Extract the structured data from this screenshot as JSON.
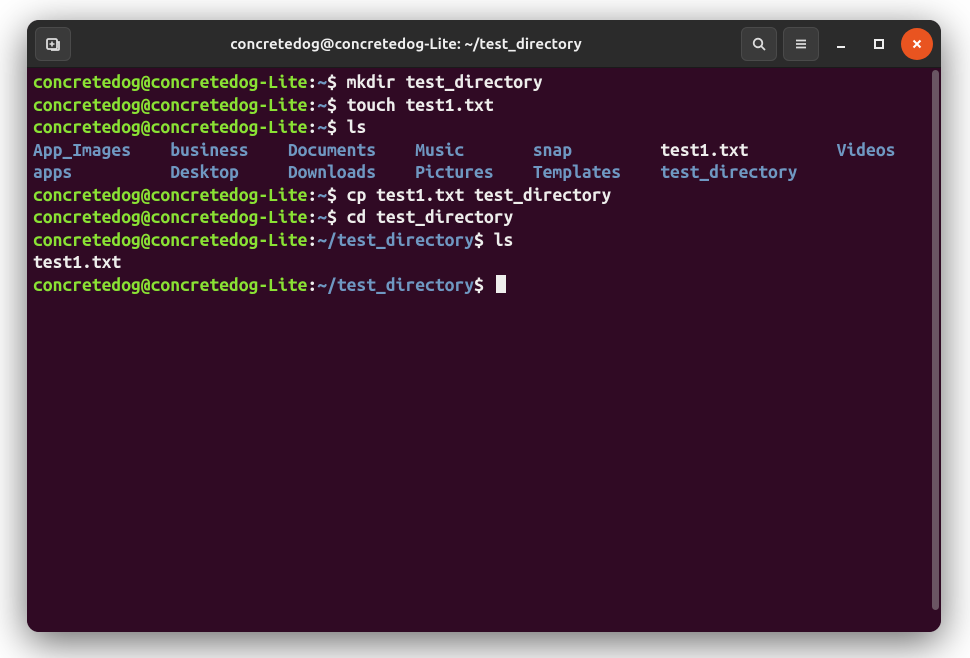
{
  "window": {
    "title": "concretedog@concretedog-Lite: ~/test_directory"
  },
  "colors": {
    "term_bg": "#300a24",
    "prompt_user": "#8ae234",
    "prompt_path": "#6f98c2",
    "text": "#eeeeec",
    "close": "#e95420",
    "titlebar": "#2b2b2b"
  },
  "prompt": {
    "user_host": "concretedog@concretedog-Lite",
    "home_path": "~",
    "sub_path": "~/test_directory",
    "sep": ":",
    "sigil": "$"
  },
  "lines": [
    {
      "type": "cmd",
      "path": "~",
      "text": "mkdir test_directory"
    },
    {
      "type": "cmd",
      "path": "~",
      "text": "touch test1.txt"
    },
    {
      "type": "cmd",
      "path": "~",
      "text": "ls"
    },
    {
      "type": "ls_row",
      "cells": [
        {
          "text": "App_Images",
          "kind": "dir"
        },
        {
          "text": "business",
          "kind": "dir"
        },
        {
          "text": "Documents",
          "kind": "dir"
        },
        {
          "text": "Music",
          "kind": "dir"
        },
        {
          "text": "snap",
          "kind": "dir"
        },
        {
          "text": "test1.txt",
          "kind": "file"
        },
        {
          "text": "Videos",
          "kind": "dir"
        }
      ]
    },
    {
      "type": "ls_row",
      "cells": [
        {
          "text": "apps",
          "kind": "dir"
        },
        {
          "text": "Desktop",
          "kind": "dir"
        },
        {
          "text": "Downloads",
          "kind": "dir"
        },
        {
          "text": "Pictures",
          "kind": "dir"
        },
        {
          "text": "Templates",
          "kind": "dir"
        },
        {
          "text": "test_directory",
          "kind": "dir"
        }
      ]
    },
    {
      "type": "cmd",
      "path": "~",
      "text": "cp test1.txt test_directory"
    },
    {
      "type": "cmd",
      "path": "~",
      "text": "cd test_directory"
    },
    {
      "type": "cmd",
      "path": "~/test_directory",
      "text": "ls"
    },
    {
      "type": "out",
      "text": "test1.txt"
    },
    {
      "type": "cmd",
      "path": "~/test_directory",
      "text": "",
      "cursor": true
    }
  ],
  "ls_col_widths": [
    12,
    10,
    11,
    10,
    11,
    16,
    6
  ]
}
